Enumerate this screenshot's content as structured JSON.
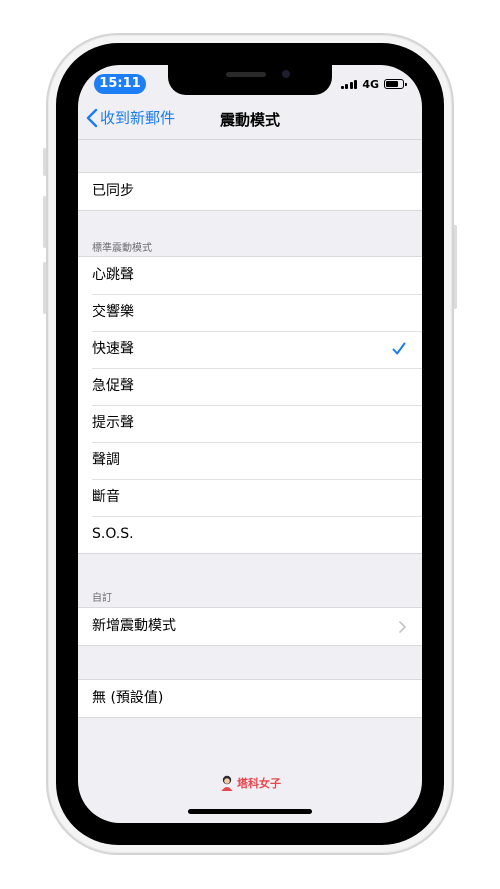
{
  "status_bar": {
    "time": "15:11",
    "network": "4G",
    "accent_color": "#1e7ef5",
    "battery_level": 0.8
  },
  "nav": {
    "back_label": "收到新郵件",
    "title": "震動模式"
  },
  "sync_group": {
    "items": [
      "已同步"
    ]
  },
  "standard_section": {
    "header": "標準震動模式",
    "items": [
      "心跳聲",
      "交響樂",
      "快速聲",
      "急促聲",
      "提示聲",
      "聲調",
      "斷音",
      "S.O.S."
    ],
    "selected": "快速聲"
  },
  "custom_section": {
    "header": "自訂",
    "items": [
      "新增震動模式"
    ]
  },
  "none_group": {
    "items": [
      "無 (預設值)"
    ]
  },
  "watermark": {
    "text": "塔科女子"
  },
  "colors": {
    "tint": "#1a7cf0",
    "background": "#efeff4"
  }
}
